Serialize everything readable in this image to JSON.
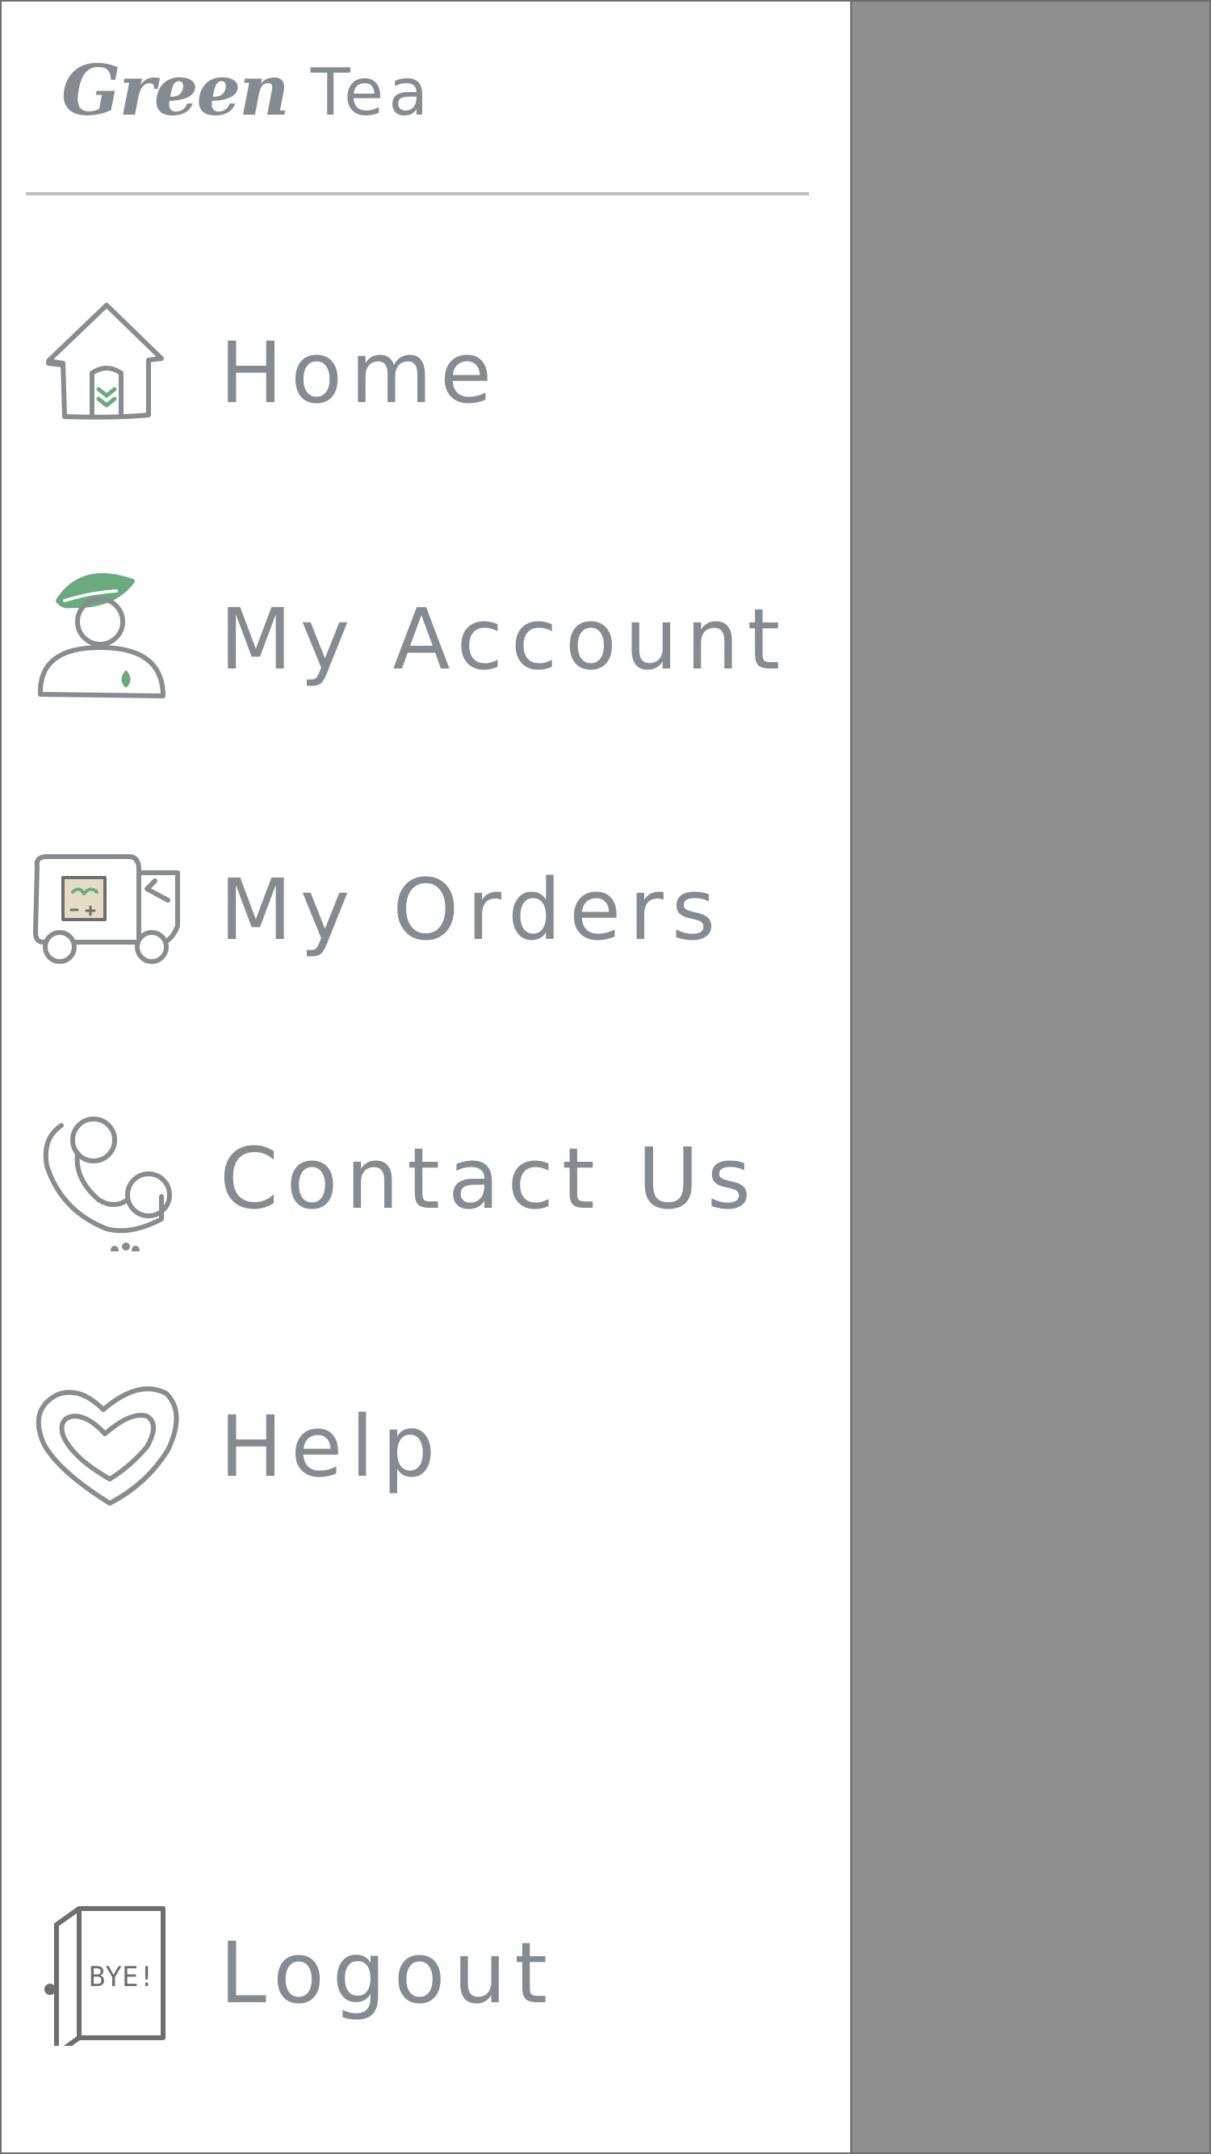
{
  "brand": {
    "script_word": "Green",
    "word": "Tea"
  },
  "menu": {
    "items": [
      {
        "label": "Home",
        "icon": "house-icon"
      },
      {
        "label": "My Account",
        "icon": "user-leaf-icon"
      },
      {
        "label": "My Orders",
        "icon": "delivery-truck-icon"
      },
      {
        "label": "Contact Us",
        "icon": "phone-handset-icon"
      },
      {
        "label": "Help",
        "icon": "heart-icon"
      }
    ],
    "logout": {
      "label": "Logout",
      "icon": "door-bye-icon",
      "sign": "BYE!"
    }
  },
  "colors": {
    "text": "#858c91",
    "icon_stroke": "#878c90",
    "leaf_green": "#6aaa7e",
    "overlay": "#8f8f8f",
    "drawer_bg": "#ffffff"
  }
}
